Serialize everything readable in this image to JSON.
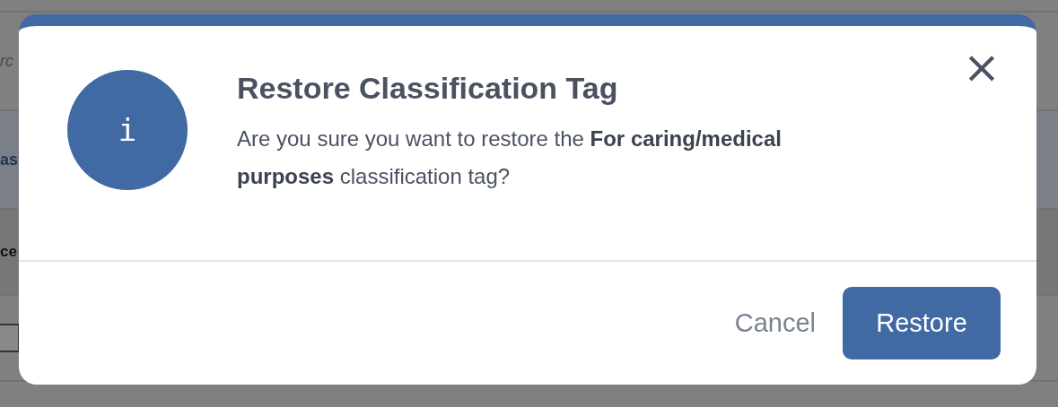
{
  "background": {
    "search_placeholder": "rc",
    "heading": "as",
    "column_header": "ce",
    "row_checkbox": {
      "checked": false
    }
  },
  "dialog": {
    "icon_glyph": "i",
    "title": "Restore Classification Tag",
    "message": "Are you sure you want to restore the **For caring/medical purposes** classification tag?",
    "close_glyph": "×",
    "buttons": [
      {
        "label": "Cancel",
        "kind": "secondary"
      },
      {
        "label": "Restore",
        "kind": "primary"
      }
    ]
  }
}
